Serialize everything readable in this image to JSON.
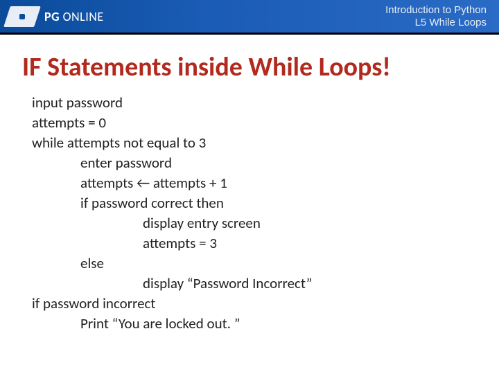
{
  "header": {
    "brand_bold": "PG",
    "brand_rest": " ONLINE",
    "title1": "Introduction to Python",
    "title2": "L5 While Loops"
  },
  "slide": {
    "heading": "IF Statements inside While Loops!",
    "code": [
      {
        "text": "input password",
        "indent": 0
      },
      {
        "text": "attempts = 0",
        "indent": 0
      },
      {
        "text": "while attempts not equal to 3",
        "indent": 0
      },
      {
        "text": "enter password",
        "indent": 1
      },
      {
        "text": "attempts ← attempts + 1",
        "indent": 1
      },
      {
        "text": "if password correct then",
        "indent": 1
      },
      {
        "text": "display entry screen",
        "indent": 2
      },
      {
        "text": "attempts = 3",
        "indent": 2
      },
      {
        "text": "else",
        "indent": 1
      },
      {
        "text": "display “Password Incorrect”",
        "indent": 2
      },
      {
        "text": "if password incorrect",
        "indent": 0
      },
      {
        "text": "Print “You are locked out. ”",
        "indent": 1
      }
    ]
  }
}
